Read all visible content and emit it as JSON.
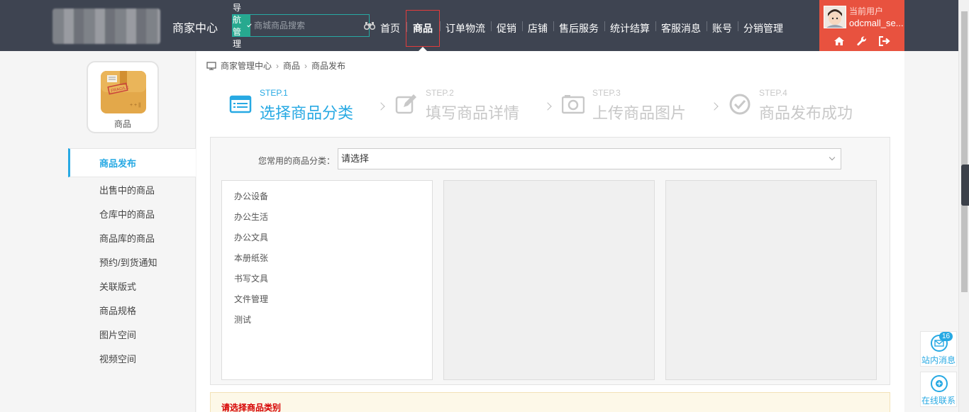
{
  "header": {
    "brand_title": "商家中心",
    "nav_dropdown_label": "导航管理",
    "search_placeholder": "商城商品搜索",
    "menu": [
      "首页",
      "商品",
      "订单物流",
      "促销",
      "店铺",
      "售后服务",
      "统计结算",
      "客服消息",
      "账号",
      "分销管理"
    ],
    "active_menu": "商品",
    "user_label": "当前用户",
    "user_name": "odcmall_se..."
  },
  "sidebar": {
    "icon_label": "商品",
    "items": [
      "商品发布",
      "出售中的商品",
      "仓库中的商品",
      "商品库的商品",
      "预约/到货通知",
      "关联版式",
      "商品规格",
      "图片空间",
      "视频空间"
    ],
    "active": "商品发布"
  },
  "breadcrumb": [
    "商家管理中心",
    "商品",
    "商品发布"
  ],
  "steps": [
    {
      "num": "STEP.1",
      "title": "选择商品分类",
      "state": "done"
    },
    {
      "num": "STEP.2",
      "title": "填写商品详情",
      "state": "pending"
    },
    {
      "num": "STEP.3",
      "title": "上传商品图片",
      "state": "pending"
    },
    {
      "num": "STEP.4",
      "title": "商品发布成功",
      "state": "pending"
    }
  ],
  "category": {
    "common_label": "您常用的商品分类：",
    "common_select_value": "请选择",
    "level1": [
      "办公设备",
      "办公生活",
      "办公文具",
      "本册纸张",
      "书写文具",
      "文件管理",
      "测试"
    ]
  },
  "notice": "请选择商品类别",
  "float": {
    "message_label": "站内消息",
    "message_count": "16",
    "contact_label": "在线联系"
  },
  "colors": {
    "header_bg": "#3e4451",
    "accent": "#27a9e3",
    "user_box": "#e8523f",
    "nav_green": "#27a98f",
    "notice_red": "#d60000"
  }
}
